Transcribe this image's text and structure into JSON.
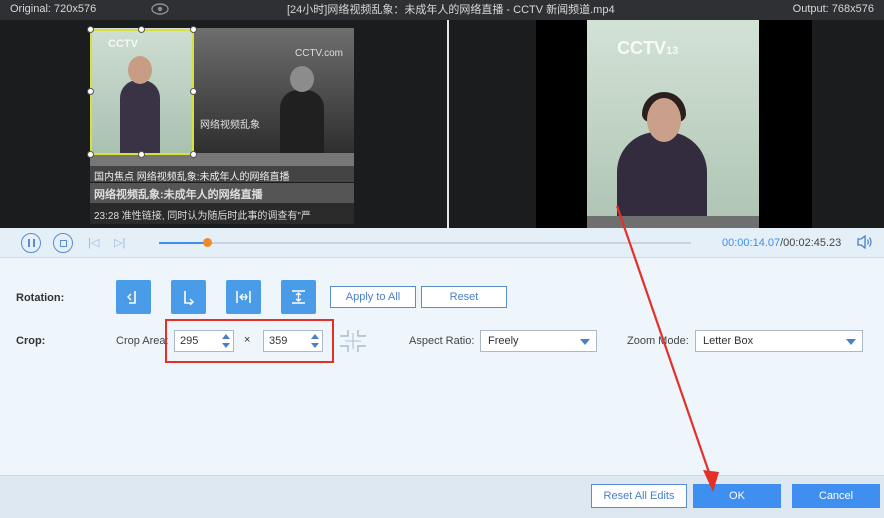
{
  "titlebar": {
    "original": "Original: 720x576",
    "filename": "[24小时]网络视频乱象：未成年人的网络直播 - CCTV 新闻频道.mp4",
    "output": "Output: 768x576"
  },
  "preview": {
    "cctv_logo_small": "CCTV",
    "cctv_logo_right": "CCTV.com",
    "overlay_text": "网络视频乱象",
    "caption_top": "国内焦点  网络视频乱象:未成年人的网络直播",
    "caption_mid": "网络视频乱象:未成年人的网络直播",
    "caption_bottom": "23:28 准性链接, 同时认为随后时此事的调查有\"严",
    "output_logo": "CCTV",
    "output_channel": "13"
  },
  "playback": {
    "current_time": "00:00:14.07",
    "total_time": "/00:02:45.23",
    "progress": 0.09
  },
  "rotation": {
    "label": "Rotation:",
    "apply_all": "Apply to All",
    "reset": "Reset"
  },
  "crop": {
    "label": "Crop:",
    "area_label": "Crop Area:",
    "width": "295",
    "height": "359",
    "times": "×",
    "aspect_label": "Aspect Ratio:",
    "aspect_value": "Freely",
    "zoom_label": "Zoom Mode:",
    "zoom_value": "Letter Box"
  },
  "footer": {
    "reset_all": "Reset All Edits",
    "ok": "OK",
    "cancel": "Cancel"
  },
  "colors": {
    "accent": "#3e8ff0",
    "knob": "#f08a24",
    "highlight": "#e5302a",
    "crop_border": "#d8e03a"
  }
}
